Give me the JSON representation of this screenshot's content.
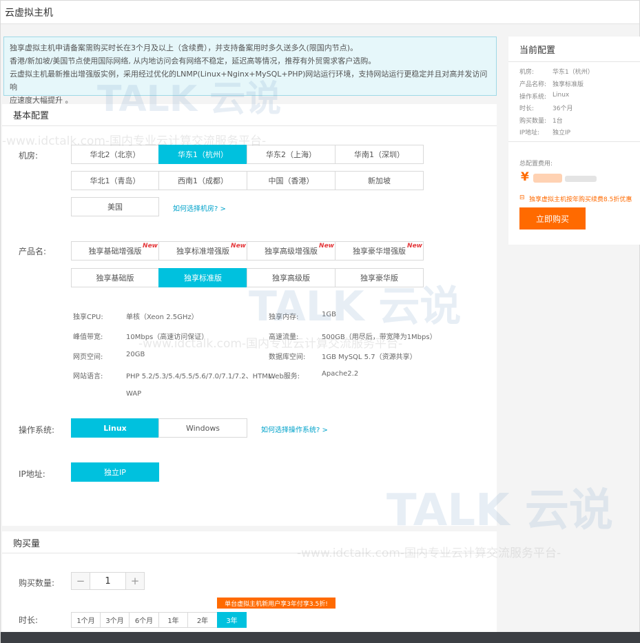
{
  "window": {
    "title": "云虚拟主机"
  },
  "notice": [
    "独享虚拟主机申请备案需购买时长在3个月及以上（含续费），并支持备案用时多久送多久(限国内节点)。",
    "香港/新加坡/美国节点使用国际网络, 从内地访问会有网络不稳定，延迟高等情况，推荐有外贸需求客户选购。",
    "云虚拟主机最新推出增强版实例，采用经过优化的LNMP(Linux+Nginx+MySQL+PHP)网站运行环境，支持网站运行更稳定并且对高并发访问响",
    "应速度大幅提升 。"
  ],
  "basic": {
    "section_title": "基本配置",
    "region_label": "机房:",
    "regions": [
      "华北2（北京）",
      "华东1（杭州）",
      "华东2（上海）",
      "华南1（深圳）",
      "华北1（青岛）",
      "西南1（成都）",
      "中国（香港）",
      "新加坡",
      "美国"
    ],
    "region_selected": "华东1（杭州）",
    "region_help": "如何选择机房? >",
    "product_label": "产品名:",
    "products_enhanced": [
      "独享基础增强版",
      "独享标准增强版",
      "独享高级增强版",
      "独享豪华增强版"
    ],
    "new_badge": "New",
    "products": [
      "独享基础版",
      "独享标准版",
      "独享高级版",
      "独享豪华版"
    ],
    "product_selected": "独享标准版",
    "specs": {
      "cpu_label": "独享CPU:",
      "cpu": "单核（Xeon 2.5GHz）",
      "mem_label": "独享内存:",
      "mem": "1GB",
      "bw_label": "峰值带宽:",
      "bw": "10Mbps（高速访问保证）",
      "traffic_label": "高速流量:",
      "traffic": "500GB（用尽后，带宽降为1Mbps）",
      "web_label": "网页空间:",
      "web": "20GB",
      "db_label": "数据库空间:",
      "db": "1GB MySQL 5.7（资源共享）",
      "lang_label": "网站语言:",
      "lang": "PHP 5.2/5.3/5.4/5.5/5.6/7.0/7.1/7.2、HTML、",
      "lang2": "WAP",
      "server_label": "Web服务:",
      "server": "Apache2.2"
    },
    "os_label": "操作系统:",
    "os_options": [
      "Linux",
      "Windows"
    ],
    "os_help": "如何选择操作系统? >",
    "ip_label": "IP地址:",
    "ip_option": "独立IP"
  },
  "purchase": {
    "section_title": "购买量",
    "qty_label": "购买数量:",
    "qty_minus": "−",
    "qty_value": "1",
    "qty_plus": "+",
    "duration_label": "时长:",
    "promo": "单台虚拟主机新用户享3年付享3.5折!",
    "durations": [
      "1个月",
      "3个月",
      "6个月",
      "1年",
      "2年",
      "3年"
    ],
    "duration_selected": "3年"
  },
  "summary": {
    "title": "当前配置",
    "rows": [
      {
        "k": "机房:",
        "v": "华东1（杭州）"
      },
      {
        "k": "产品名称:",
        "v": "独享标准版"
      },
      {
        "k": "操作系统:",
        "v": "Linux"
      },
      {
        "k": "时长:",
        "v": "36个月"
      },
      {
        "k": "购买数量:",
        "v": "1台"
      },
      {
        "k": "IP地址:",
        "v": "独立IP"
      }
    ],
    "total_label": "总配置费用:",
    "currency": "¥",
    "discount": "独享虚拟主机按年购买续费8.5折优惠",
    "buy_button": "立即购买"
  },
  "watermark": {
    "brand": "TALK 云说",
    "url": "-www.idctalk.com-国内专业云计算交流服务平台-"
  },
  "colors": {
    "accent": "#00c1de",
    "orange": "#ff6a00"
  }
}
